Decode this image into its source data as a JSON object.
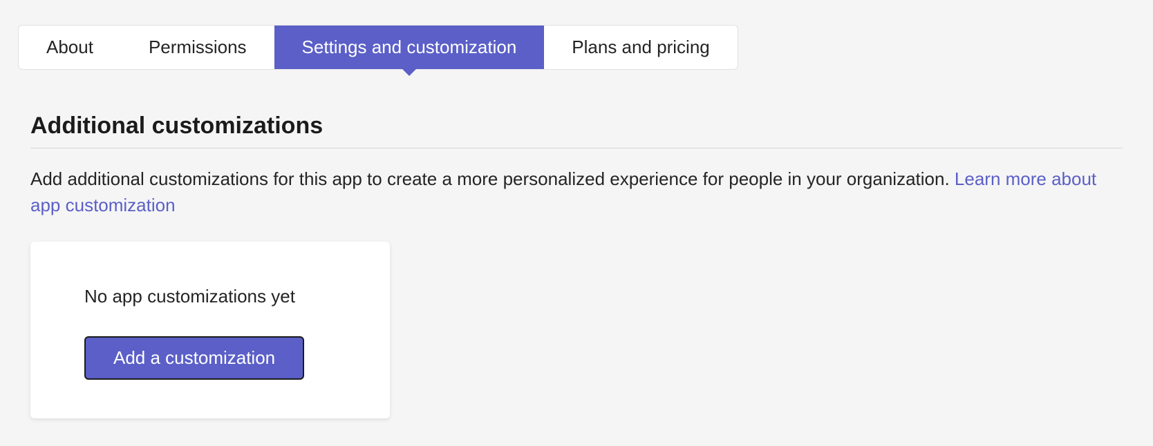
{
  "tabs": [
    {
      "label": "About",
      "active": false
    },
    {
      "label": "Permissions",
      "active": false
    },
    {
      "label": "Settings and customization",
      "active": true
    },
    {
      "label": "Plans and pricing",
      "active": false
    }
  ],
  "section": {
    "title": "Additional customizations",
    "description": "Add additional customizations for this app to create a more personalized experience for people in your organization. ",
    "link_text": "Learn more about app customization"
  },
  "card": {
    "empty_text": "No app customizations yet",
    "button_label": "Add a customization"
  },
  "colors": {
    "accent": "#5b5fc7",
    "link": "#5b5fc7",
    "bg": "#f5f5f5"
  }
}
